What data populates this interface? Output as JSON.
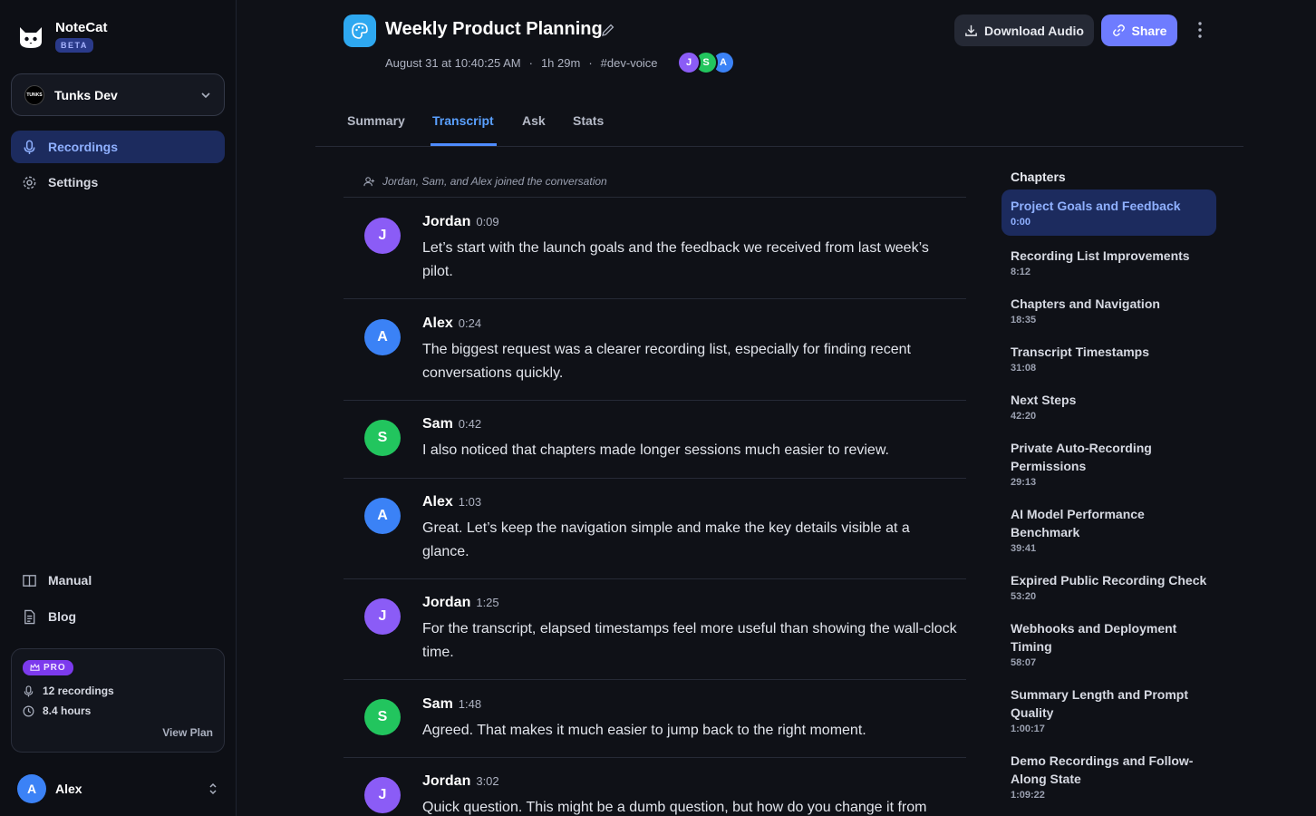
{
  "app": {
    "name": "NoteCat",
    "badge": "BETA"
  },
  "workspace": {
    "logo_text": "TUNKS",
    "name": "Tunks Dev"
  },
  "nav": {
    "recordings": "Recordings",
    "settings": "Settings",
    "manual": "Manual",
    "blog": "Blog"
  },
  "plan": {
    "badge": "PRO",
    "recordings": "12 recordings",
    "hours": "8.4 hours",
    "view_plan": "View Plan"
  },
  "user": {
    "initial": "A",
    "name": "Alex"
  },
  "header": {
    "title": "Weekly Product Planning",
    "date": "August 31 at 10:40:25 AM",
    "duration": "1h 29m",
    "channel": "#dev-voice",
    "participants": [
      {
        "initial": "J",
        "color": "#8b5cf6"
      },
      {
        "initial": "S",
        "color": "#22c55e"
      },
      {
        "initial": "A",
        "color": "#3b82f6"
      }
    ],
    "download_label": "Download Audio",
    "share_label": "Share"
  },
  "tabs": [
    "Summary",
    "Transcript",
    "Ask",
    "Stats"
  ],
  "active_tab": "Transcript",
  "transcript": {
    "joined": "Jordan, Sam, and Alex joined the conversation",
    "messages": [
      {
        "initial": "J",
        "color": "#8b5cf6",
        "speaker": "Jordan",
        "time": "0:09",
        "text": "Let’s start with the launch goals and the feedback we received from last week’s pilot."
      },
      {
        "initial": "A",
        "color": "#3b82f6",
        "speaker": "Alex",
        "time": "0:24",
        "text": "The biggest request was a clearer recording list, especially for finding recent conversations quickly."
      },
      {
        "initial": "S",
        "color": "#22c55e",
        "speaker": "Sam",
        "time": "0:42",
        "text": "I also noticed that chapters made longer sessions much easier to review."
      },
      {
        "initial": "A",
        "color": "#3b82f6",
        "speaker": "Alex",
        "time": "1:03",
        "text": "Great. Let’s keep the navigation simple and make the key details visible at a glance."
      },
      {
        "initial": "J",
        "color": "#8b5cf6",
        "speaker": "Jordan",
        "time": "1:25",
        "text": "For the transcript, elapsed timestamps feel more useful than showing the wall-clock time."
      },
      {
        "initial": "S",
        "color": "#22c55e",
        "speaker": "Sam",
        "time": "1:48",
        "text": "Agreed. That makes it much easier to jump back to the right moment."
      },
      {
        "initial": "J",
        "color": "#8b5cf6",
        "speaker": "Jordan",
        "time": "3:02",
        "text": "Quick question. This might be a dumb question, but how do you change it from light"
      }
    ]
  },
  "chapters": {
    "title": "Chapters",
    "items": [
      {
        "title": "Project Goals and Feedback",
        "time": "0:00"
      },
      {
        "title": "Recording List Improvements",
        "time": "8:12"
      },
      {
        "title": "Chapters and Navigation",
        "time": "18:35"
      },
      {
        "title": "Transcript Timestamps",
        "time": "31:08"
      },
      {
        "title": "Next Steps",
        "time": "42:20"
      },
      {
        "title": "Private Auto-Recording Permissions",
        "time": "29:13"
      },
      {
        "title": "AI Model Performance Benchmark",
        "time": "39:41"
      },
      {
        "title": "Expired Public Recording Check",
        "time": "53:20"
      },
      {
        "title": "Webhooks and Deployment Timing",
        "time": "58:07"
      },
      {
        "title": "Summary Length and Prompt Quality",
        "time": "1:00:17"
      },
      {
        "title": "Demo Recordings and Follow-Along State",
        "time": "1:09:22"
      }
    ]
  },
  "colors": {
    "accent": "#6e7cff",
    "active_nav_bg": "#1c2b5e",
    "active_text": "#8fb0ff",
    "title_icon": "#2ea8f0"
  }
}
